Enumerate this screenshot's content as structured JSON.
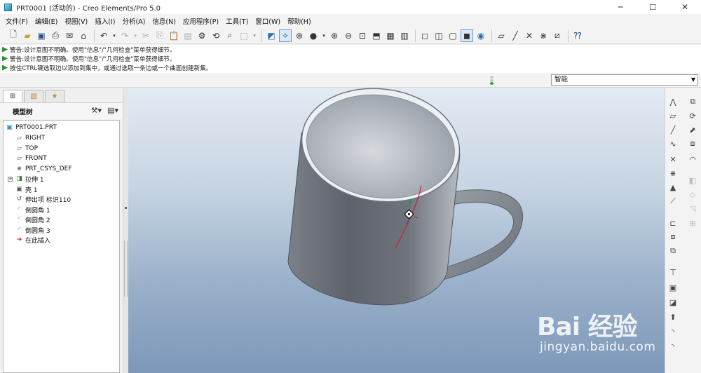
{
  "window": {
    "title": "PRT0001 (活动的) - Creo Elements/Pro 5.0",
    "controls": {
      "minimize": "─",
      "maximize": "☐",
      "close": "✕"
    }
  },
  "menubar": {
    "items": [
      "文件(F)",
      "编辑(E)",
      "视图(V)",
      "插入(I)",
      "分析(A)",
      "信息(N)",
      "应用程序(P)",
      "工具(T)",
      "窗口(W)",
      "帮助(H)"
    ]
  },
  "messages": [
    {
      "type": "warning",
      "text": "警告:设计意图不明确。使用\"信息\"/\"几何检查\"菜单获得细节。"
    },
    {
      "type": "warning",
      "text": "警告:设计意图不明确。使用\"信息\"/\"几何检查\"菜单获得细节。"
    },
    {
      "type": "info",
      "text": "按住CTRL键选取边以添加到集中，或通过选取一条边或一个曲面创建新集。"
    }
  ],
  "filter": {
    "selected": "智能"
  },
  "model_tree": {
    "header": "模型树",
    "items": [
      {
        "label": "PRT0001.PRT",
        "icon": "part-icon"
      },
      {
        "label": "RIGHT",
        "icon": "datum-plane-icon"
      },
      {
        "label": "TOP",
        "icon": "datum-plane-icon"
      },
      {
        "label": "FRONT",
        "icon": "datum-plane-icon"
      },
      {
        "label": "PRT_CSYS_DEF",
        "icon": "csys-icon"
      },
      {
        "label": "拉伸 1",
        "icon": "extrude-icon"
      },
      {
        "label": "壳 1",
        "icon": "shell-icon"
      },
      {
        "label": "伸出项 标识110",
        "icon": "sweep-icon"
      },
      {
        "label": "倒圆角 1",
        "icon": "round-icon"
      },
      {
        "label": "倒圆角 2",
        "icon": "round-icon"
      },
      {
        "label": "倒圆角 3",
        "icon": "round-icon"
      },
      {
        "label": "在此插入",
        "icon": "insert-here-icon"
      }
    ]
  },
  "colors": {
    "viewport_top": "#e3ebf3",
    "viewport_bottom": "#7d98b8",
    "mug_body": "#6e737b",
    "selection_edge": "#d0202a"
  },
  "watermark": {
    "brand": "Bai 经验",
    "url": "jingyan.baidu.com"
  }
}
